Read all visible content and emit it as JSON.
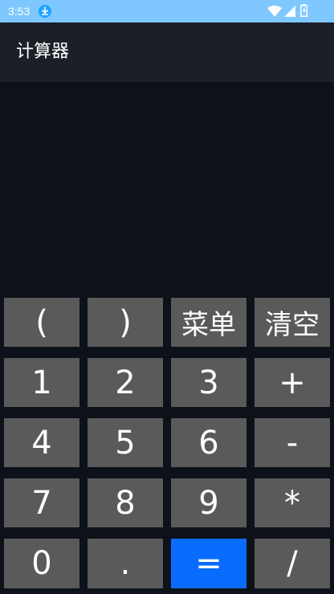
{
  "status_bar": {
    "time": "3:53",
    "icons": [
      "download-icon",
      "wifi-icon",
      "signal-icon",
      "battery-icon"
    ],
    "background": "#7fc7ff"
  },
  "app_bar": {
    "title": "计算器",
    "background": "#1b1f27"
  },
  "display": {
    "expression": ""
  },
  "keypad": {
    "row1": [
      "(",
      ")",
      "菜单",
      "清空"
    ],
    "row2": [
      "1",
      "2",
      "3",
      "+"
    ],
    "row3": [
      "4",
      "5",
      "6",
      "-"
    ],
    "row4": [
      "7",
      "8",
      "9",
      "*"
    ],
    "row5": [
      "0",
      ".",
      "=",
      "/"
    ]
  },
  "colors": {
    "key_background": "#5a5a5a",
    "equals_background": "#0a6cff",
    "screen_background": "#0d1119"
  }
}
